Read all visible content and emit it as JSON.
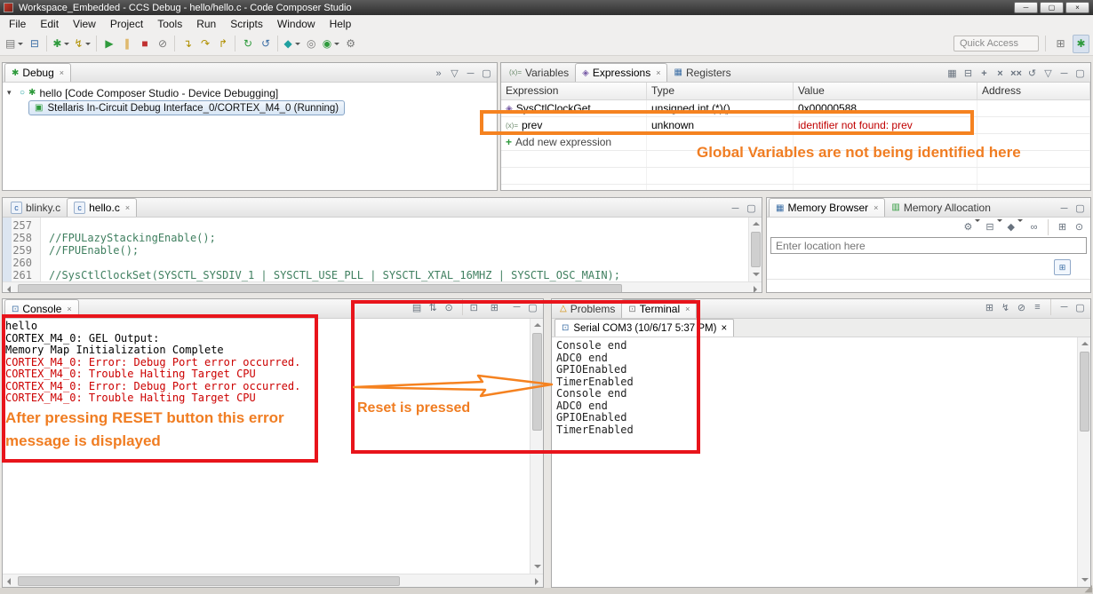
{
  "titlebar": {
    "title": "Workspace_Embedded - CCS Debug - hello/hello.c - Code Composer Studio"
  },
  "menubar": {
    "items": [
      "File",
      "Edit",
      "View",
      "Project",
      "Tools",
      "Run",
      "Scripts",
      "Window",
      "Help"
    ]
  },
  "toolbar": {
    "quick_access": "Quick Access"
  },
  "colors": {
    "annotation_orange": "#f58220",
    "annotation_box_red": "#e8141b",
    "console_error_red": "#cc0000",
    "comment_green": "#3f7f5f",
    "value_error_red": "#c00000"
  },
  "icons": {
    "minimize": "─",
    "maximize": "▢",
    "close": "×",
    "new_file": "▤",
    "save": "⊟",
    "debug": "✱",
    "flash": "↯",
    "resume": "▶",
    "suspend": "∥",
    "terminate": "■",
    "disconnect": "⊘",
    "step_into": "↴",
    "step_over": "↷",
    "step_return": "↱",
    "restart": "↻",
    "refresh": "↺",
    "target": "◆",
    "search": "◎",
    "external_tools": "◉",
    "gear": "⚙",
    "open_perspective": "⊞",
    "view_menu": "▽",
    "overflow": "»",
    "expander": "▾",
    "launch": "○",
    "bug": "✱",
    "chip": "▣",
    "variables_tab": "(x)=",
    "expressions_tab": "◈",
    "registers_tab": "▦",
    "expr_item": "◈",
    "add": "+",
    "remove": "×",
    "remove_all": "××",
    "show_types": "▦",
    "collapse": "⊟",
    "c_file": "c",
    "memory_tab": "▦",
    "alloc_tab": "▥",
    "link": "∞",
    "diamond": "◆",
    "new_tab": "⊞",
    "pin": "⊙",
    "go": "▶",
    "console": "⊡",
    "console_clear": "▤",
    "scroll_lock": "⇅",
    "display_console": "⊡",
    "open_console": "⊞",
    "problems_tab": "△",
    "terminal_tab": "⊡",
    "serial": "⊡",
    "connect": "↯",
    "settings": "≡",
    "resize_grip": "◢"
  },
  "debug_view": {
    "tab": "Debug",
    "root_node": "hello [Code Composer Studio - Device Debugging]",
    "child_node": "Stellaris In-Circuit Debug Interface_0/CORTEX_M4_0 (Running)"
  },
  "expressions_view": {
    "tabs": {
      "variables": "Variables",
      "expressions": "Expressions",
      "registers": "Registers"
    },
    "columns": {
      "expression": "Expression",
      "type": "Type",
      "value": "Value",
      "address": "Address"
    },
    "rows": [
      {
        "expression": "SysCtlClockGet",
        "type": "unsigned int (*)()",
        "value": "0x00000588",
        "address": ""
      },
      {
        "expression": "prev",
        "type": "unknown",
        "value": "identifier not found: prev",
        "address": ""
      },
      {
        "expression": "Add new expression",
        "type": "",
        "value": "",
        "address": ""
      }
    ]
  },
  "editor": {
    "tabs": {
      "blinky": "blinky.c",
      "hello": "hello.c"
    },
    "lines": [
      {
        "num": "257",
        "code": ""
      },
      {
        "num": "258",
        "code": "//FPULazyStackingEnable();"
      },
      {
        "num": "259",
        "code": "//FPUEnable();"
      },
      {
        "num": "260",
        "code": ""
      },
      {
        "num": "261",
        "code": "//SysCtlClockSet(SYSCTL_SYSDIV_1 | SYSCTL_USE_PLL | SYSCTL_XTAL_16MHZ | SYSCTL_OSC_MAIN);"
      }
    ]
  },
  "memory_view": {
    "tabs": {
      "browser": "Memory Browser",
      "allocation": "Memory Allocation"
    },
    "location_placeholder": "Enter location here"
  },
  "console_view": {
    "tab": "Console",
    "lines": [
      {
        "text": "hello",
        "error": false
      },
      {
        "text": "CORTEX_M4_0: GEL Output:",
        "error": false
      },
      {
        "text": "Memory Map Initialization Complete",
        "error": false
      },
      {
        "text": "CORTEX_M4_0: Error: Debug Port error occurred.",
        "error": true
      },
      {
        "text": "CORTEX_M4_0: Trouble Halting Target CPU",
        "error": true
      },
      {
        "text": "CORTEX_M4_0: Error: Debug Port error occurred.",
        "error": true
      },
      {
        "text": "CORTEX_M4_0: Trouble Halting Target CPU",
        "error": true
      }
    ]
  },
  "terminal_view": {
    "tabs": {
      "problems": "Problems",
      "terminal": "Terminal"
    },
    "session_tab": "Serial COM3 (10/6/17 5:37 PM)",
    "lines": [
      "Console end",
      "ADC0 end",
      "GPIOEnabled",
      "TimerEnabled",
      "Console end",
      "ADC0 end",
      "GPIOEnabled",
      "TimerEnabled"
    ]
  },
  "annotations": {
    "expressions_note": "Global Variables are not being identified here",
    "console_note": "After pressing RESET button this error message is displayed",
    "reset_note": "Reset is pressed"
  }
}
